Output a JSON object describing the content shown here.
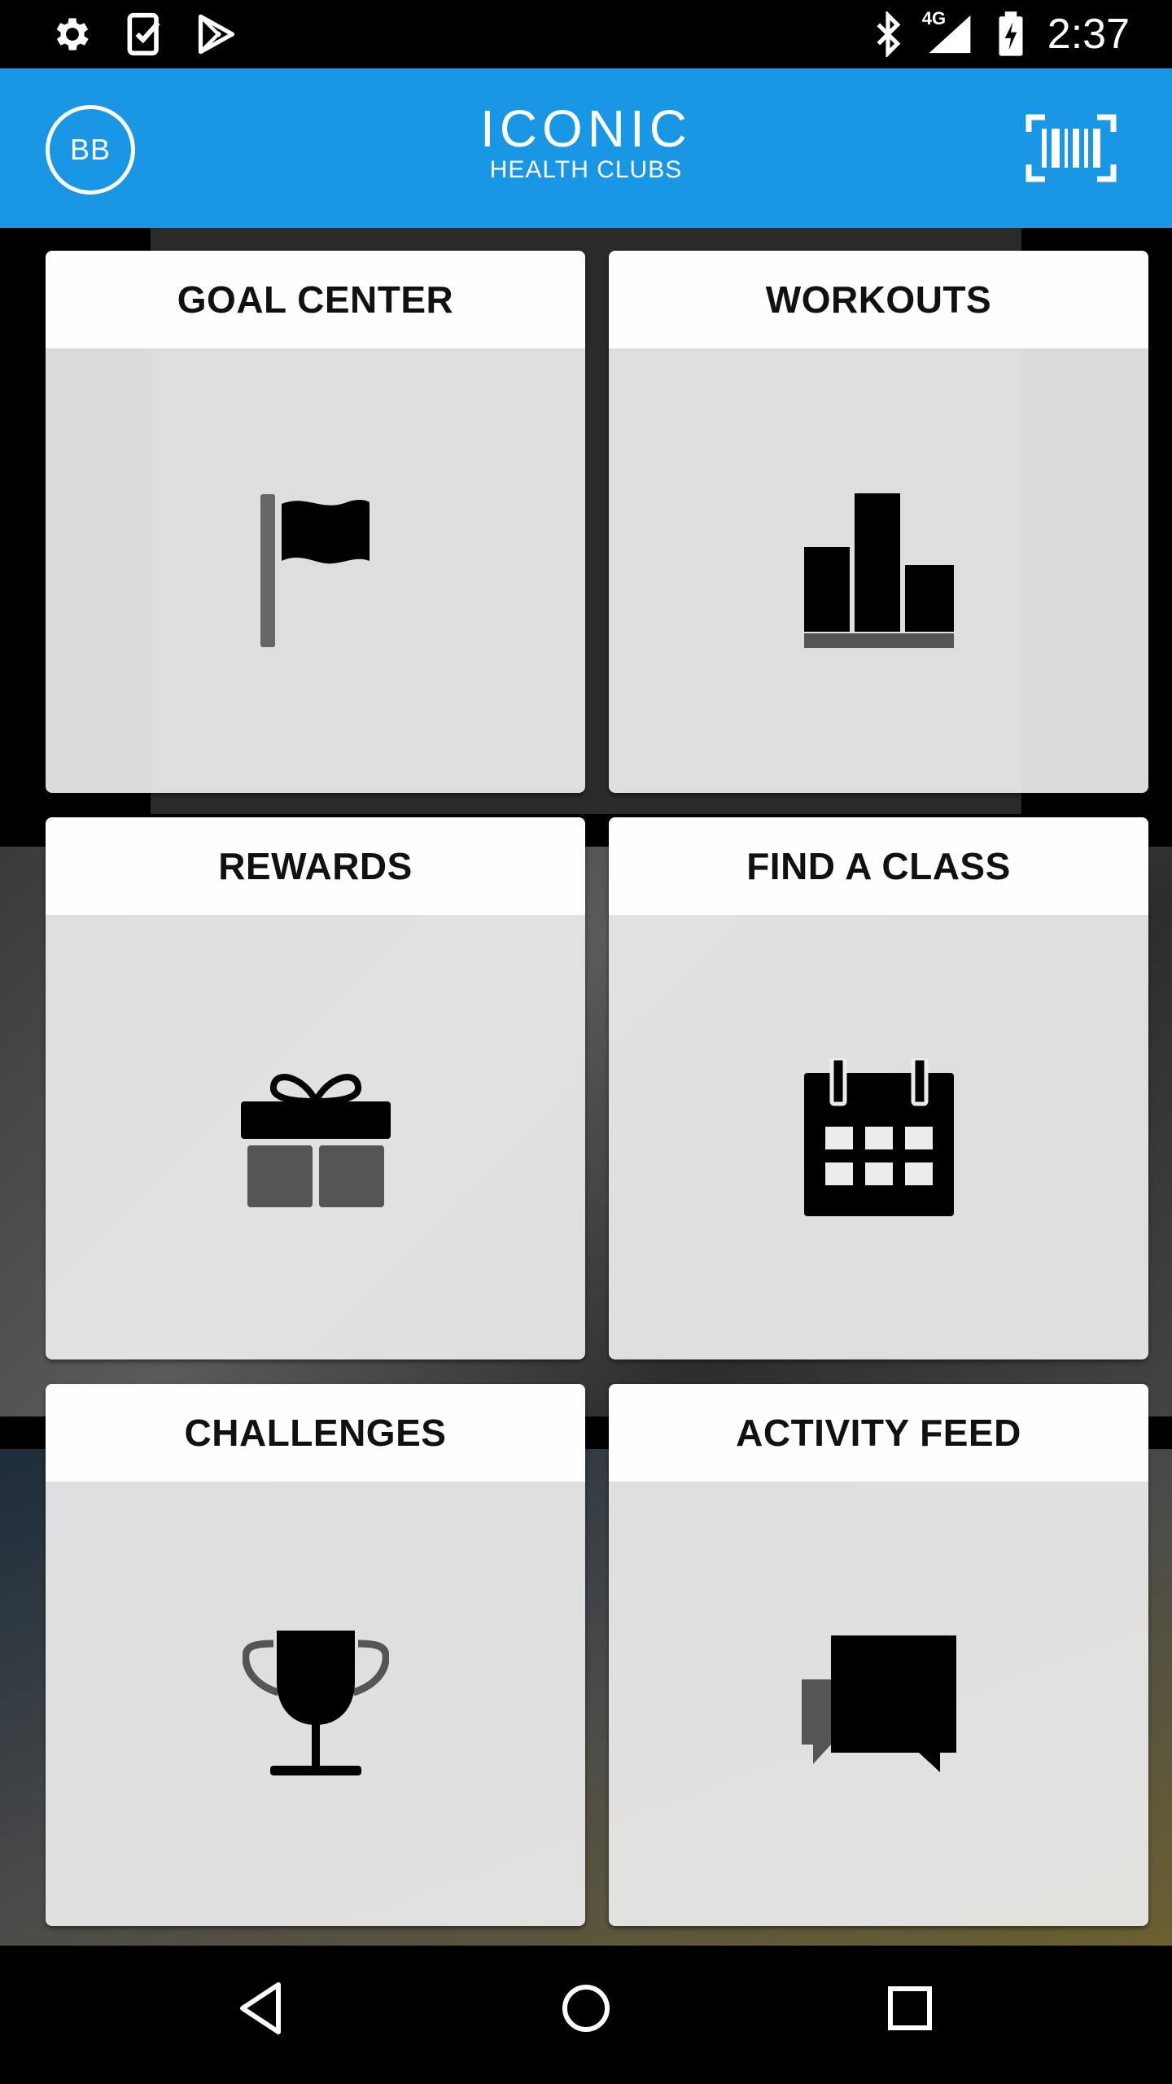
{
  "status_bar": {
    "time": "2:37",
    "network": "4G",
    "icons_left": [
      "settings-icon",
      "task-check-icon",
      "play-store-icon"
    ],
    "icons_right": [
      "bluetooth-icon",
      "signal-icon",
      "battery-charging-icon"
    ]
  },
  "header": {
    "avatar_initials": "BB",
    "logo_line1": "ICONIC",
    "logo_line2": "HEALTH CLUBS",
    "right_icon": "barcode-icon"
  },
  "tiles": [
    {
      "label": "GOAL CENTER",
      "icon": "flag-icon"
    },
    {
      "label": "WORKOUTS",
      "icon": "bar-chart-icon"
    },
    {
      "label": "REWARDS",
      "icon": "gift-icon"
    },
    {
      "label": "FIND A CLASS",
      "icon": "calendar-icon"
    },
    {
      "label": "CHALLENGES",
      "icon": "trophy-icon"
    },
    {
      "label": "ACTIVITY FEED",
      "icon": "chat-icon"
    }
  ],
  "nav_bar": {
    "buttons": [
      "back-icon",
      "home-icon",
      "recents-icon"
    ]
  },
  "colors": {
    "app_bar": "#1a97e4",
    "tile_body": "#ececec",
    "tile_head": "#ffffff",
    "icon": "#000000",
    "icon_secondary": "#555555"
  }
}
